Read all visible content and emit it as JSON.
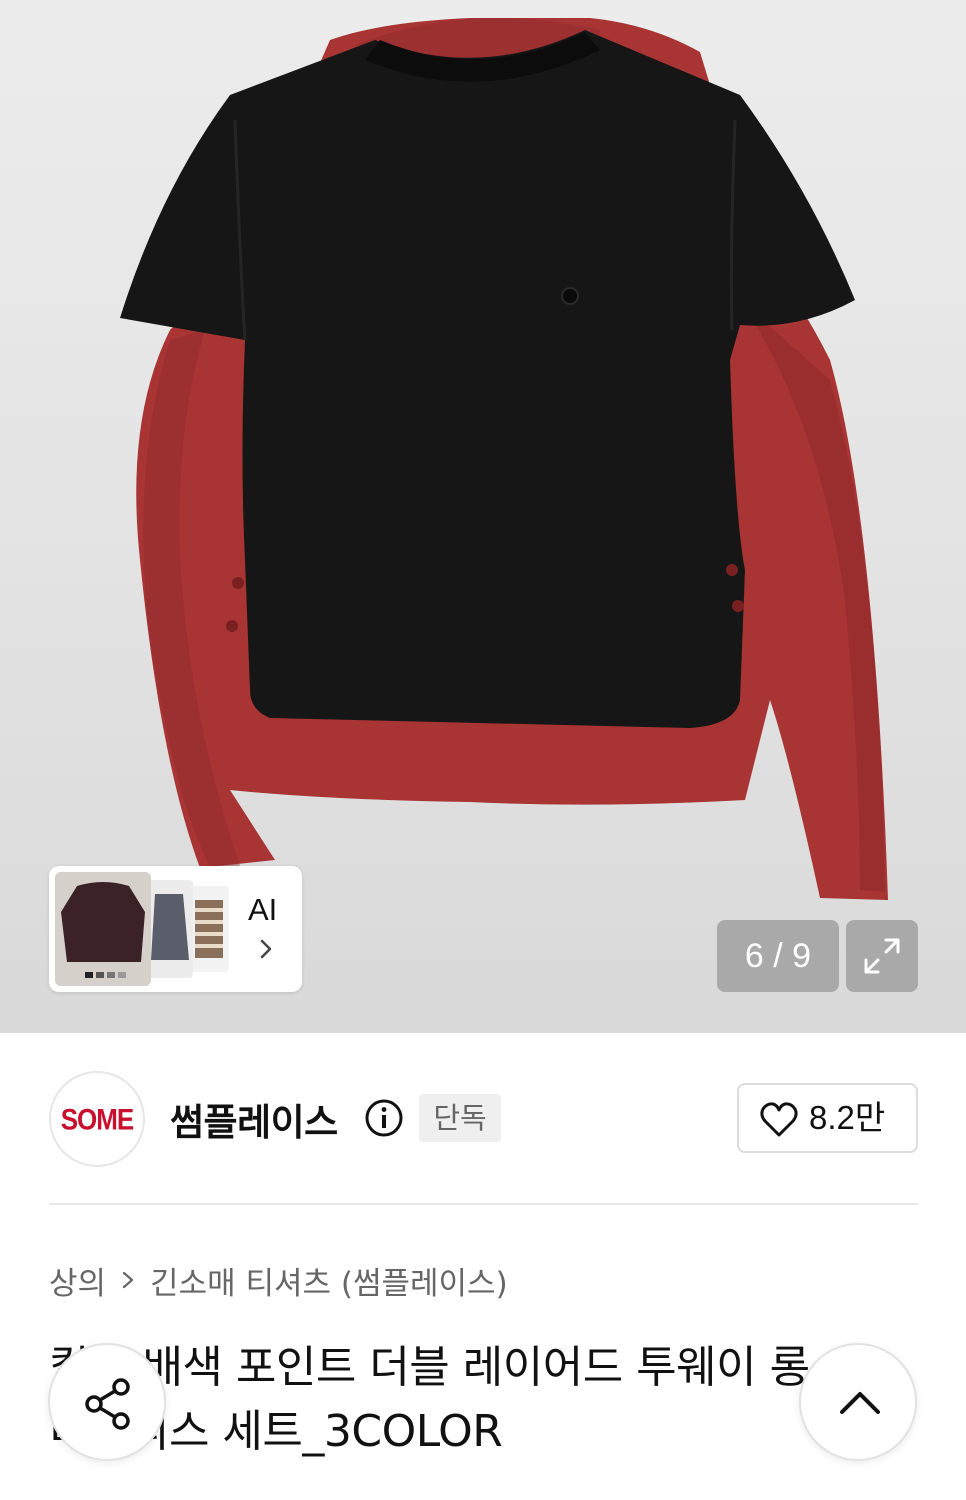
{
  "gallery": {
    "ai_label": "AI",
    "counter": "6 / 9",
    "expand_icon": "expand-icon"
  },
  "store": {
    "logo_text": "SOME",
    "name": "썸플레이스",
    "info_icon": "info-icon",
    "badge": "단독",
    "like_count": "8.2만",
    "brand_color": "#c8102e"
  },
  "breadcrumb": {
    "category": "상의",
    "subcategory": "긴소매 티셔츠 (썸플레이스)"
  },
  "product": {
    "title": "컬러 배색 포인트 더블 레이어드 투웨이 롱 슬리브리스 세트_3COLOR"
  },
  "floating": {
    "share_icon": "share-icon",
    "scroll_top_icon": "chevron-up-icon"
  }
}
